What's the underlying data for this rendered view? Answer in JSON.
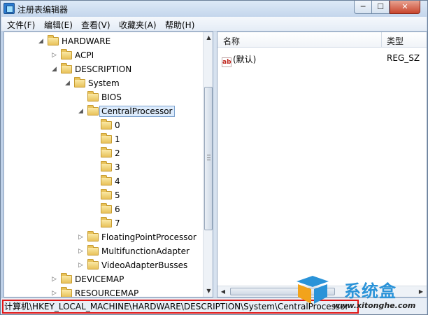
{
  "window": {
    "title": "注册表编辑器",
    "min_label": "─",
    "max_label": "☐",
    "close_label": "✕"
  },
  "menu": [
    "文件(F)",
    "编辑(E)",
    "查看(V)",
    "收藏夹(A)",
    "帮助(H)"
  ],
  "tree": {
    "nodes": [
      {
        "label": "HARDWARE",
        "expander": "◢"
      },
      {
        "label": "ACPI",
        "expander": "▷"
      },
      {
        "label": "DESCRIPTION",
        "expander": "◢"
      },
      {
        "label": "System",
        "expander": "◢"
      },
      {
        "label": "BIOS",
        "expander": ""
      },
      {
        "label": "CentralProcessor",
        "expander": "◢",
        "selected": true
      },
      {
        "label": "0",
        "expander": ""
      },
      {
        "label": "1",
        "expander": ""
      },
      {
        "label": "2",
        "expander": ""
      },
      {
        "label": "3",
        "expander": ""
      },
      {
        "label": "4",
        "expander": ""
      },
      {
        "label": "5",
        "expander": ""
      },
      {
        "label": "6",
        "expander": ""
      },
      {
        "label": "7",
        "expander": ""
      },
      {
        "label": "FloatingPointProcessor",
        "expander": "▷"
      },
      {
        "label": "MultifunctionAdapter",
        "expander": "▷"
      },
      {
        "label": "VideoAdapterBusses",
        "expander": "▷"
      },
      {
        "label": "DEVICEMAP",
        "expander": "▷"
      },
      {
        "label": "RESOURCEMAP",
        "expander": "▷"
      }
    ]
  },
  "list": {
    "columns": [
      "名称",
      "类型"
    ],
    "rows": [
      {
        "name": "(默认)",
        "type": "REG_SZ",
        "icon_text": "ab"
      }
    ]
  },
  "status": {
    "path": "计算机\\HKEY_LOCAL_MACHINE\\HARDWARE\\DESCRIPTION\\System\\CentralProcessor"
  },
  "watermark": {
    "name": "系统盒",
    "url": "www.xitonghe.com"
  }
}
